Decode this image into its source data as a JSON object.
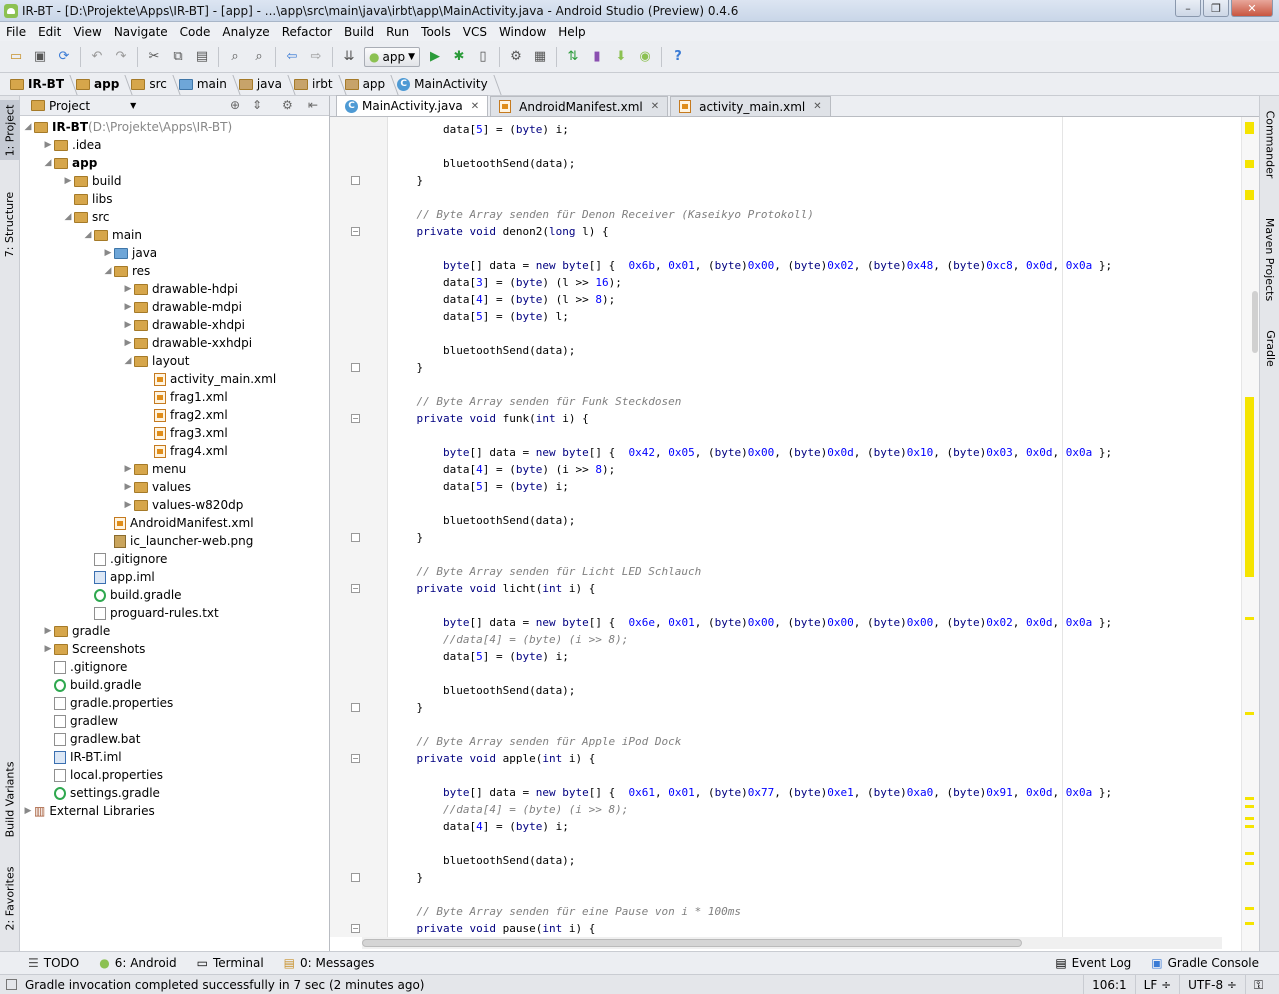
{
  "window": {
    "title": "IR-BT - [D:\\Projekte\\Apps\\IR-BT] - [app] - ...\\app\\src\\main\\java\\irbt\\app\\MainActivity.java - Android Studio (Preview) 0.4.6"
  },
  "menu": [
    "File",
    "Edit",
    "View",
    "Navigate",
    "Code",
    "Analyze",
    "Refactor",
    "Build",
    "Run",
    "Tools",
    "VCS",
    "Window",
    "Help"
  ],
  "toolbar": {
    "run_config": "app"
  },
  "breadcrumbs": [
    "IR-BT",
    "app",
    "src",
    "main",
    "java",
    "irbt",
    "app",
    "MainActivity"
  ],
  "left_tabs": [
    "1: Project",
    "7: Structure",
    "Build Variants",
    "2: Favorites"
  ],
  "right_tabs": [
    "Commander",
    "Maven Projects",
    "Gradle"
  ],
  "project": {
    "header": "Project",
    "tree": [
      {
        "d": 0,
        "label": "IR-BT",
        "extra": " (D:\\Projekte\\Apps\\IR-BT)",
        "icon": "folder",
        "open": true,
        "bold": true
      },
      {
        "d": 1,
        "label": ".idea",
        "icon": "folder",
        "open": false
      },
      {
        "d": 1,
        "label": "app",
        "icon": "folder",
        "open": true,
        "bold": true
      },
      {
        "d": 2,
        "label": "build",
        "icon": "folder",
        "open": false
      },
      {
        "d": 2,
        "label": "libs",
        "icon": "folder",
        "leaf": true
      },
      {
        "d": 2,
        "label": "src",
        "icon": "folder",
        "open": true
      },
      {
        "d": 3,
        "label": "main",
        "icon": "folder",
        "open": true
      },
      {
        "d": 4,
        "label": "java",
        "icon": "folder-blue",
        "open": false
      },
      {
        "d": 4,
        "label": "res",
        "icon": "folder-res",
        "open": true
      },
      {
        "d": 5,
        "label": "drawable-hdpi",
        "icon": "folder",
        "open": false
      },
      {
        "d": 5,
        "label": "drawable-mdpi",
        "icon": "folder",
        "open": false
      },
      {
        "d": 5,
        "label": "drawable-xhdpi",
        "icon": "folder",
        "open": false
      },
      {
        "d": 5,
        "label": "drawable-xxhdpi",
        "icon": "folder",
        "open": false
      },
      {
        "d": 5,
        "label": "layout",
        "icon": "folder",
        "open": true
      },
      {
        "d": 6,
        "label": "activity_main.xml",
        "icon": "xml",
        "leaf": true
      },
      {
        "d": 6,
        "label": "frag1.xml",
        "icon": "xml",
        "leaf": true
      },
      {
        "d": 6,
        "label": "frag2.xml",
        "icon": "xml",
        "leaf": true
      },
      {
        "d": 6,
        "label": "frag3.xml",
        "icon": "xml",
        "leaf": true
      },
      {
        "d": 6,
        "label": "frag4.xml",
        "icon": "xml",
        "leaf": true
      },
      {
        "d": 5,
        "label": "menu",
        "icon": "folder",
        "open": false
      },
      {
        "d": 5,
        "label": "values",
        "icon": "folder",
        "open": false
      },
      {
        "d": 5,
        "label": "values-w820dp",
        "icon": "folder",
        "open": false
      },
      {
        "d": 4,
        "label": "AndroidManifest.xml",
        "icon": "xml",
        "leaf": true
      },
      {
        "d": 4,
        "label": "ic_launcher-web.png",
        "icon": "png",
        "leaf": true
      },
      {
        "d": 3,
        "label": ".gitignore",
        "icon": "file",
        "leaf": true
      },
      {
        "d": 3,
        "label": "app.iml",
        "icon": "iml",
        "leaf": true
      },
      {
        "d": 3,
        "label": "build.gradle",
        "icon": "gradle",
        "leaf": true
      },
      {
        "d": 3,
        "label": "proguard-rules.txt",
        "icon": "file",
        "leaf": true
      },
      {
        "d": 1,
        "label": "gradle",
        "icon": "folder",
        "open": false
      },
      {
        "d": 1,
        "label": "Screenshots",
        "icon": "folder",
        "open": false
      },
      {
        "d": 1,
        "label": ".gitignore",
        "icon": "file",
        "leaf": true
      },
      {
        "d": 1,
        "label": "build.gradle",
        "icon": "gradle",
        "leaf": true
      },
      {
        "d": 1,
        "label": "gradle.properties",
        "icon": "file",
        "leaf": true
      },
      {
        "d": 1,
        "label": "gradlew",
        "icon": "file",
        "leaf": true
      },
      {
        "d": 1,
        "label": "gradlew.bat",
        "icon": "file",
        "leaf": true
      },
      {
        "d": 1,
        "label": "IR-BT.iml",
        "icon": "iml",
        "leaf": true
      },
      {
        "d": 1,
        "label": "local.properties",
        "icon": "file",
        "leaf": true
      },
      {
        "d": 1,
        "label": "settings.gradle",
        "icon": "gradle",
        "leaf": true
      },
      {
        "d": 0,
        "label": "External Libraries",
        "icon": "libs",
        "open": false
      }
    ]
  },
  "editor": {
    "tabs": [
      {
        "label": "MainActivity.java",
        "active": true,
        "icon": "class"
      },
      {
        "label": "AndroidManifest.xml",
        "active": false,
        "icon": "xml"
      },
      {
        "label": "activity_main.xml",
        "active": false,
        "icon": "xml"
      }
    ],
    "lines": [
      "        data[5] = (byte) i;",
      "",
      "        bluetoothSend(data);",
      "    }",
      "",
      "    // Byte Array senden für Denon Receiver (Kaseikyo Protokoll)",
      "    private void denon2(long l) {",
      "",
      "        byte[] data = new byte[] {  0x6b, 0x01, (byte)0x00, (byte)0x02, (byte)0x48, (byte)0xc8, 0x0d, 0x0a };",
      "        data[3] = (byte) (l >> 16);",
      "        data[4] = (byte) (l >> 8);",
      "        data[5] = (byte) l;",
      "",
      "        bluetoothSend(data);",
      "    }",
      "",
      "    // Byte Array senden für Funk Steckdosen",
      "    private void funk(int i) {",
      "",
      "        byte[] data = new byte[] {  0x42, 0x05, (byte)0x00, (byte)0x0d, (byte)0x10, (byte)0x03, 0x0d, 0x0a };",
      "        data[4] = (byte) (i >> 8);",
      "        data[5] = (byte) i;",
      "",
      "        bluetoothSend(data);",
      "    }",
      "",
      "    // Byte Array senden für Licht LED Schlauch",
      "    private void licht(int i) {",
      "",
      "        byte[] data = new byte[] {  0x6e, 0x01, (byte)0x00, (byte)0x00, (byte)0x00, (byte)0x02, 0x0d, 0x0a };",
      "        //data[4] = (byte) (i >> 8);",
      "        data[5] = (byte) i;",
      "",
      "        bluetoothSend(data);",
      "    }",
      "",
      "    // Byte Array senden für Apple iPod Dock",
      "    private void apple(int i) {",
      "",
      "        byte[] data = new byte[] {  0x61, 0x01, (byte)0x77, (byte)0xe1, (byte)0xa0, (byte)0x91, 0x0d, 0x0a };",
      "        //data[4] = (byte) (i >> 8);",
      "        data[4] = (byte) i;",
      "",
      "        bluetoothSend(data);",
      "    }",
      "",
      "    // Byte Array senden für eine Pause von i * 100ms",
      "    private void pause(int i) {"
    ]
  },
  "bottom_tools": [
    {
      "label": "TODO"
    },
    {
      "label": "6: Android"
    },
    {
      "label": "Terminal"
    },
    {
      "label": "0: Messages"
    }
  ],
  "bottom_right_tools": [
    {
      "label": "Event Log"
    },
    {
      "label": "Gradle Console"
    }
  ],
  "status": {
    "message": "Gradle invocation completed successfully in 7 sec (2 minutes ago)",
    "position": "106:1",
    "line_sep": "LF ÷",
    "encoding": "UTF-8 ÷"
  }
}
